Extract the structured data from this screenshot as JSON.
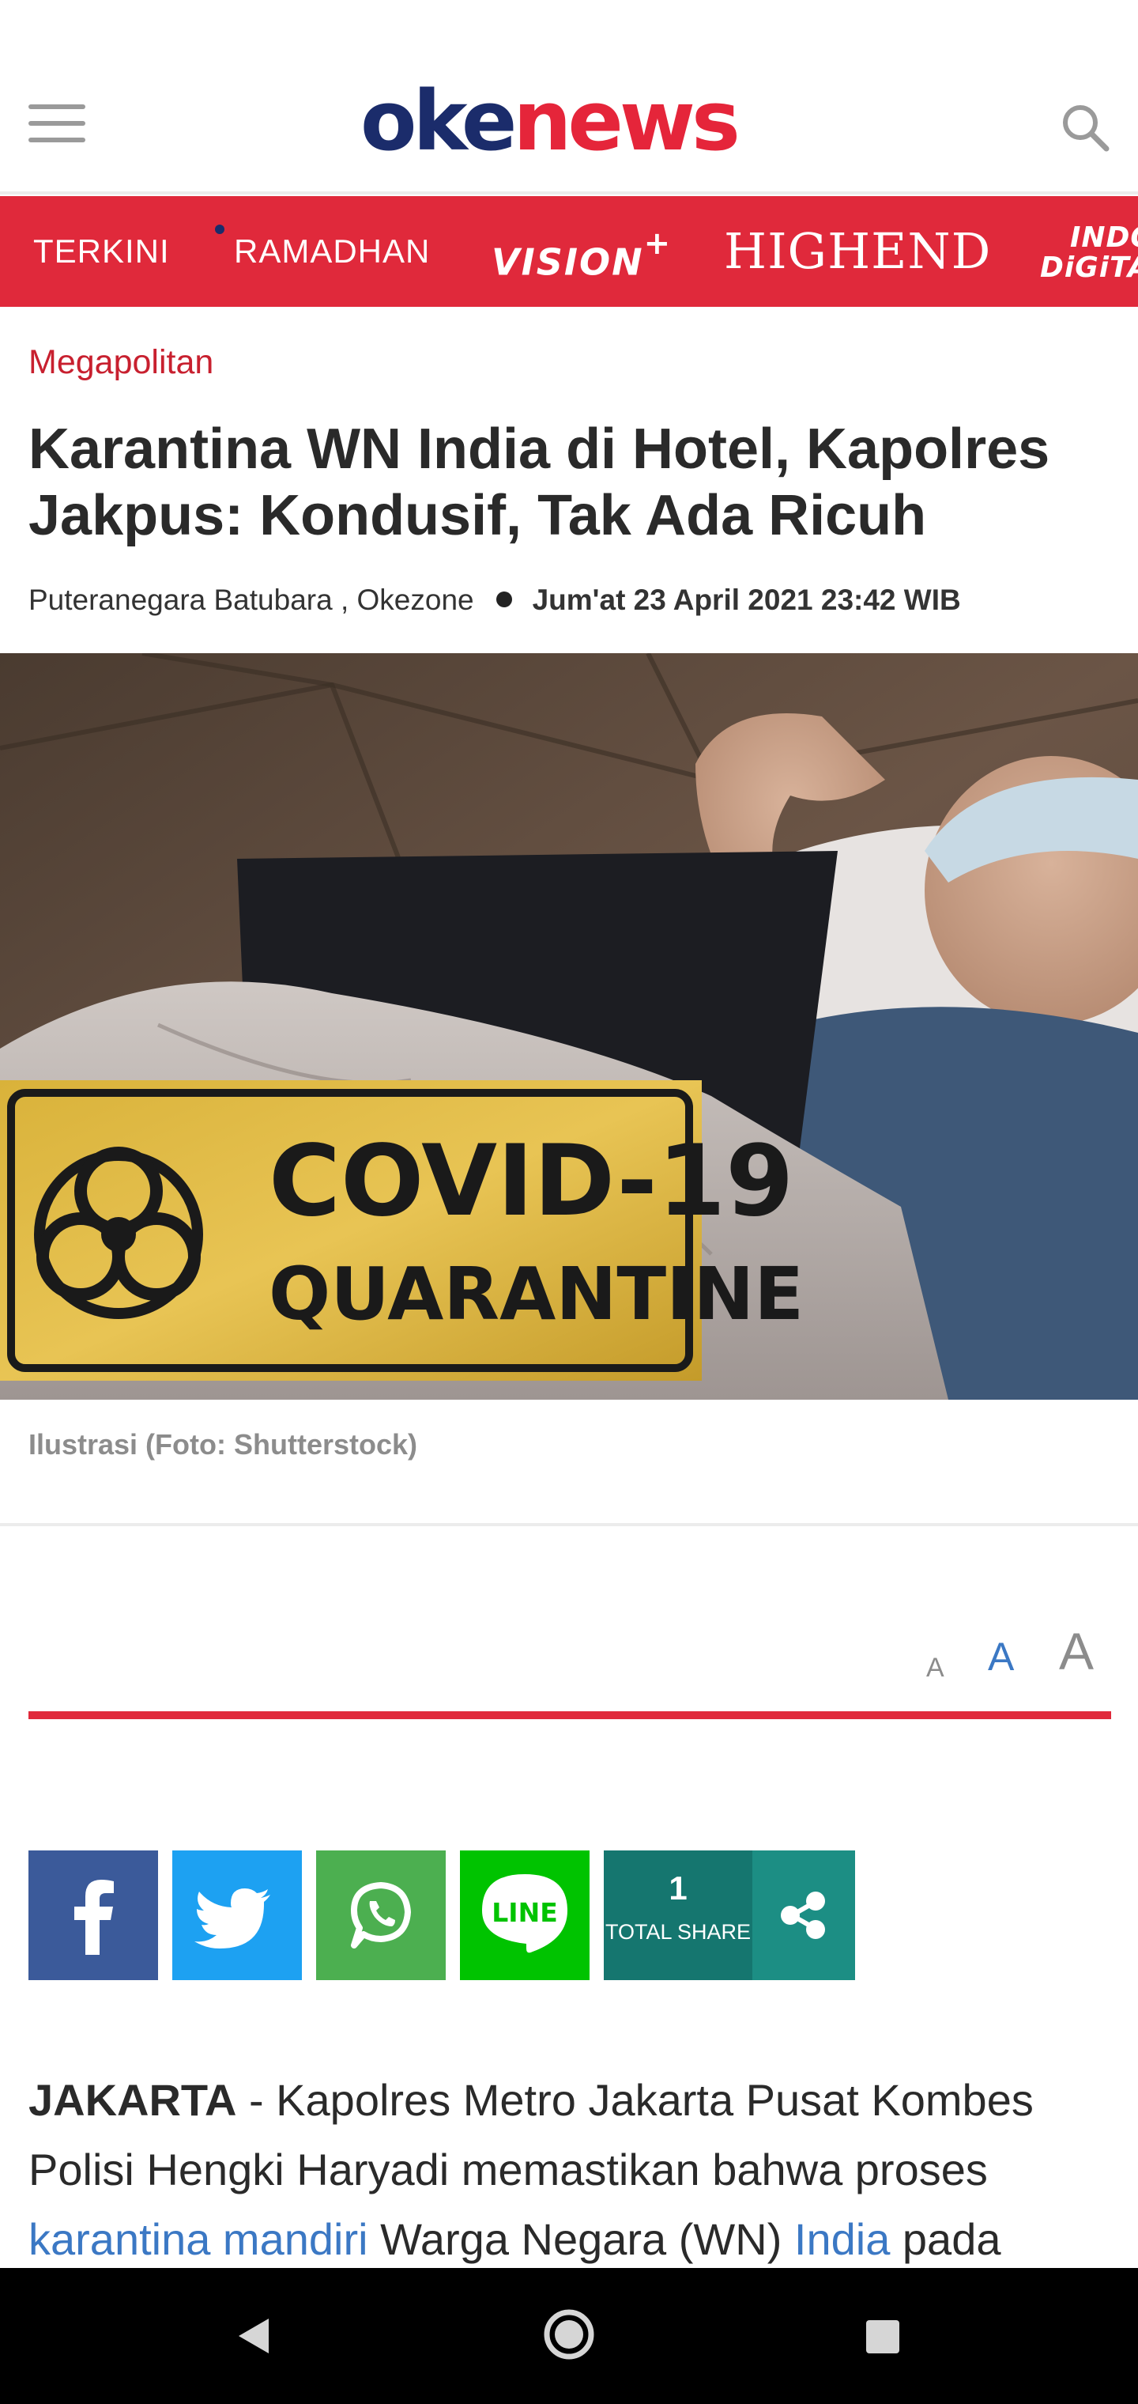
{
  "header": {
    "logo_oke": "oke",
    "logo_news": "news"
  },
  "nav": {
    "items": [
      {
        "label": "TERKINI"
      },
      {
        "label": "RAMADHAN"
      },
      {
        "label": "VISION",
        "suffix": "+"
      },
      {
        "label": "HIGHEND"
      },
      {
        "label_line1": "INDO",
        "label_line2": "DiGiTA"
      }
    ]
  },
  "article": {
    "category": "Megapolitan",
    "title": "Karantina WN India di Hotel, Kapolres Jakpus: Kondusif, Tak Ada Ricuh",
    "author": "Puteranegara Batubara , Okezone",
    "date": "Jum'at 23 April 2021 23:42 WIB",
    "image_sign_line1": "COVID-19",
    "image_sign_line2": "QUARANTINE",
    "caption": "Ilustrasi (Foto: Shutterstock)"
  },
  "font_size_controls": {
    "small": "A",
    "medium": "A",
    "large": "A"
  },
  "share": {
    "line_label": "LINE",
    "total_count": "1",
    "total_label": "TOTAL SHARE"
  },
  "body": {
    "lead": "JAKARTA",
    "text1": " - Kapolres Metro Jakarta Pusat Kombes Polisi Hengki Haryadi memastikan bahwa proses ",
    "link1": "karantina mandiri",
    "text2": " Warga Negara (WN) ",
    "link2": "India",
    "text3": " pada"
  },
  "colors": {
    "brand_red": "#e0293b",
    "brand_navy": "#1b2c6b",
    "facebook": "#3b5a9a",
    "twitter": "#1da1f2",
    "whatsapp": "#4caf50",
    "line": "#00c300",
    "share_total": "#15766f",
    "link": "#3b78c4"
  }
}
